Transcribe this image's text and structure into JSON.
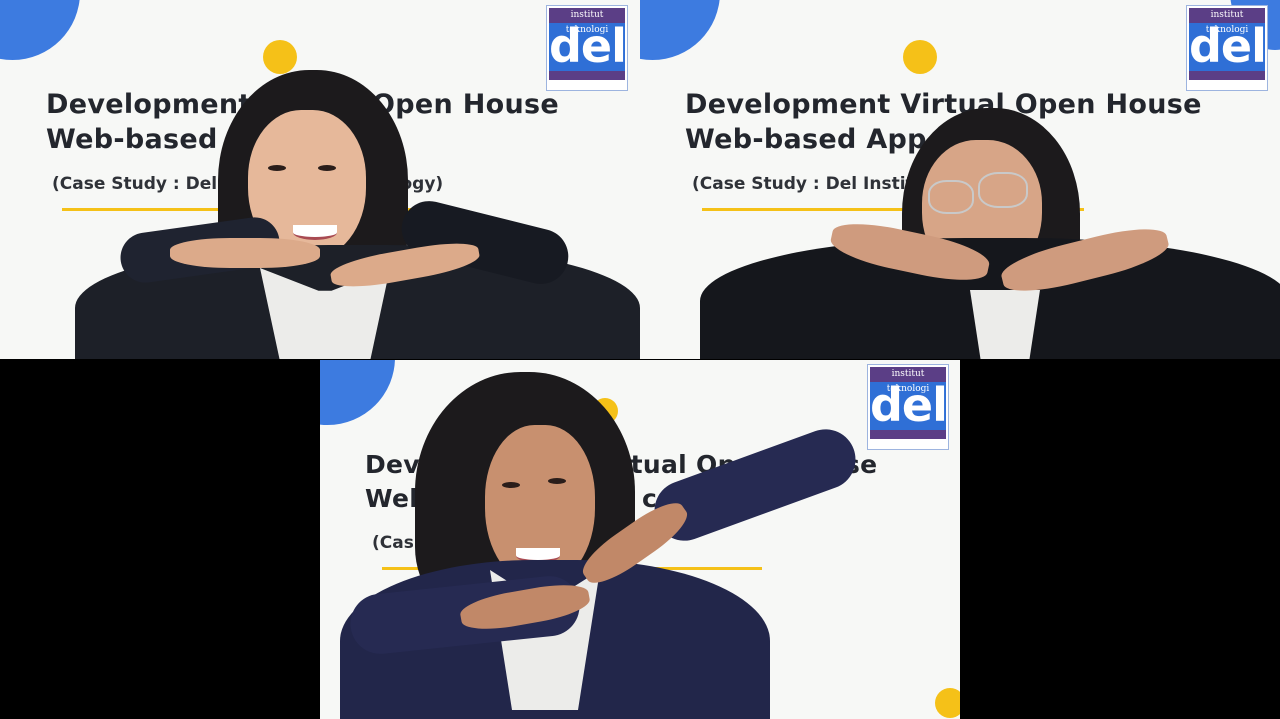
{
  "tiles": [
    {
      "title_line1": "Development",
      "title_line1_right": "Open House",
      "title_line2": "Web-based A",
      "title_line2_right": "n",
      "subtitle_left": "(Case Study : Del In",
      "subtitle_right": "ology)",
      "logo": {
        "top_text": "institut teknologi",
        "word": "del"
      }
    },
    {
      "title_line1": "Development Virtual Open House",
      "title_line2": "Web-based App",
      "subtitle_left": "(Case Study : Del Institu",
      "subtitle_right": "y)",
      "logo": {
        "top_text": "institut teknologi",
        "word": "del"
      }
    },
    {
      "title_line1_a": "Devel",
      "title_line1_b": "rtual Op",
      "title_line1_c": "se",
      "title_line2_a": "Web",
      "title_line2_b": "cati",
      "subtitle_left": "(Cas",
      "logo": {
        "top_text": "institut teknologi",
        "word": "del"
      }
    }
  ],
  "colors": {
    "accent_blue": "#3d7be0",
    "accent_yellow": "#f5c118",
    "logo_purple": "#5b3e86",
    "background": "#000000"
  }
}
